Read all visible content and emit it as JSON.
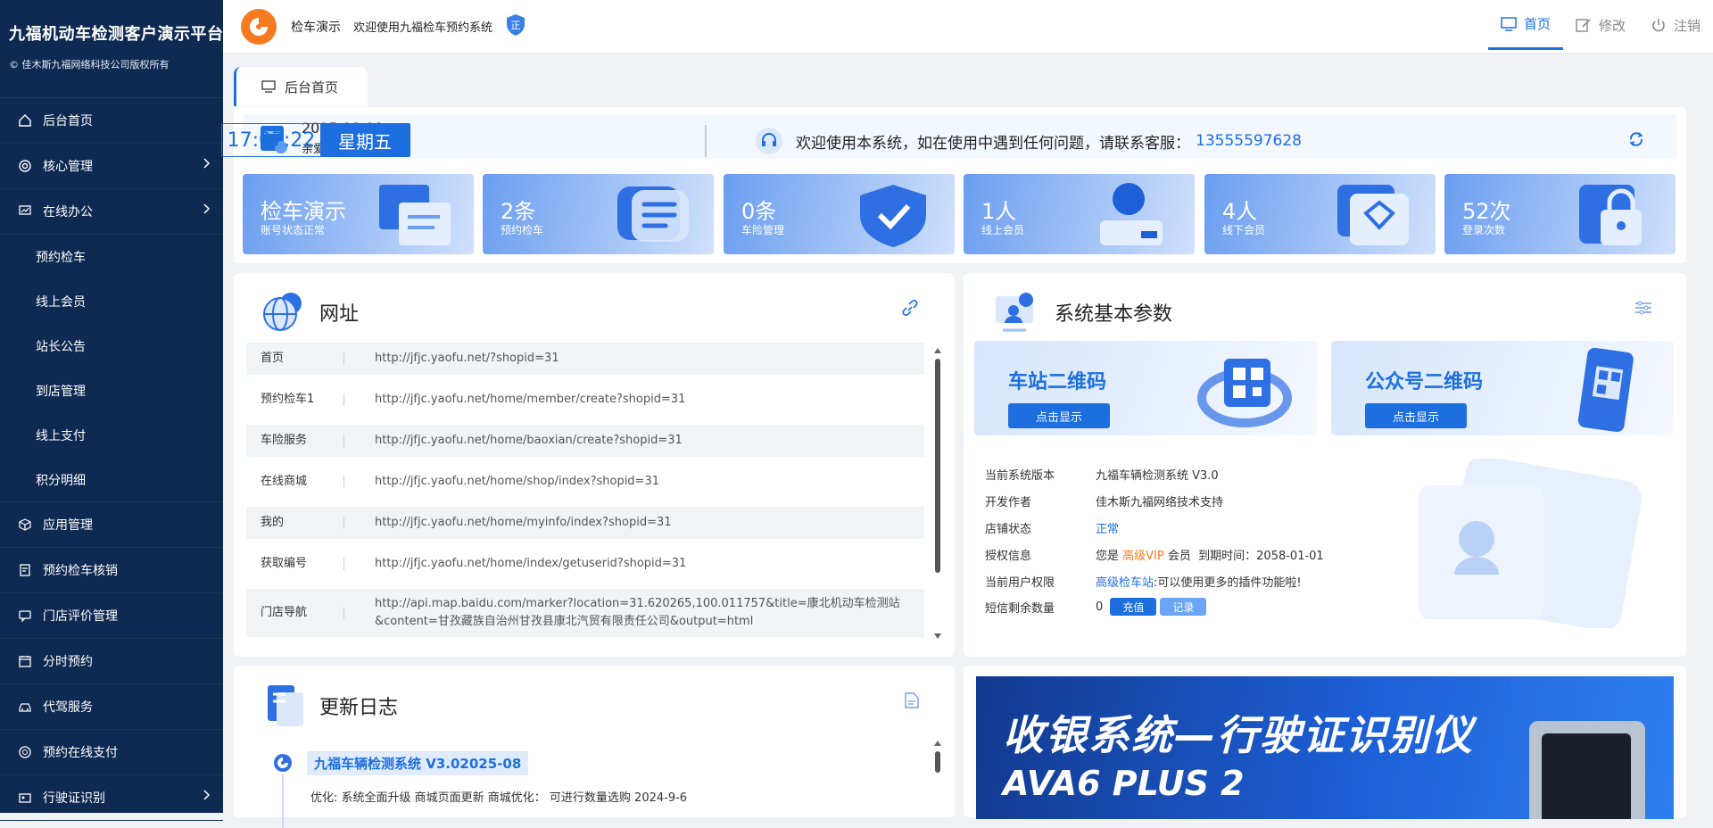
{
  "sidebar": {
    "title": "九福机动车检测客户演示平台",
    "copyright": "© 佳木斯九福网络科技公司版权所有",
    "items": [
      {
        "label": "后台首页",
        "icon": "home-icon"
      },
      {
        "label": "核心管理",
        "icon": "target-icon"
      },
      {
        "label": "在线办公",
        "icon": "monitor-chart-icon"
      }
    ],
    "subs": [
      "预约检车",
      "线上会员",
      "站长公告",
      "到店管理",
      "线上支付",
      "积分明细"
    ],
    "items2": [
      {
        "label": "应用管理",
        "icon": "cube-icon"
      },
      {
        "label": "预约检车核销",
        "icon": "clipboard-icon"
      },
      {
        "label": "门店评价管理",
        "icon": "comment-icon"
      },
      {
        "label": "分时预约",
        "icon": "calendar-icon"
      },
      {
        "label": "代驾服务",
        "icon": "car-icon"
      },
      {
        "label": "预约在线支付",
        "icon": "coin-icon"
      },
      {
        "label": "行驶证识别",
        "icon": "id-card-icon"
      }
    ]
  },
  "topbar": {
    "name": "检车演示",
    "welcome": "欢迎使用九福检车预约系统",
    "shield": "正",
    "home": "首页",
    "edit": "修改",
    "logout": "注销"
  },
  "tab": {
    "label": "后台首页"
  },
  "hero": {
    "date": "2025.08.08",
    "greeting": "亲爱的用户，下午好!",
    "time": "17:07:22",
    "weekday": "星期五",
    "notice": "欢迎使用本系统，如在使用中遇到任何问题，请联系客服：",
    "phone": "13555597628"
  },
  "cards": [
    {
      "value": "检车演示",
      "label": "账号状态正常"
    },
    {
      "value": "2条",
      "label": "预约检车"
    },
    {
      "value": "0条",
      "label": "车险管理"
    },
    {
      "value": "1人",
      "label": "线上会员"
    },
    {
      "value": "4人",
      "label": "线下会员"
    },
    {
      "value": "52次",
      "label": "登录次数"
    }
  ],
  "website": {
    "title": "网址",
    "rows": [
      {
        "k": "首页",
        "u": "http://jfjc.yaofu.net/?shopid=31"
      },
      {
        "k": "预约检车1",
        "u": "http://jfjc.yaofu.net/home/member/create?shopid=31"
      },
      {
        "k": "车险服务",
        "u": "http://jfjc.yaofu.net/home/baoxian/create?shopid=31"
      },
      {
        "k": "在线商城",
        "u": "http://jfjc.yaofu.net/home/shop/index?shopid=31"
      },
      {
        "k": "我的",
        "u": "http://jfjc.yaofu.net/home/myinfo/index?shopid=31"
      },
      {
        "k": "获取编号",
        "u": "http://jfjc.yaofu.net/home/index/getuserid?shopid=31"
      },
      {
        "k": "门店导航",
        "u": "http://api.map.baidu.com/marker?location=31.620265,100.011757&title=康北机动车检测站",
        "u2": "&content=甘孜藏族自治州甘孜县康北汽贸有限责任公司&output=html"
      }
    ]
  },
  "params": {
    "title": "系统基本参数",
    "qr1": {
      "title": "车站二维码",
      "btn": "点击显示"
    },
    "qr2": {
      "title": "公众号二维码",
      "btn": "点击显示"
    },
    "version": {
      "k": "当前系统版本",
      "v": "九福车辆检测系统 V3.0"
    },
    "author": {
      "k": "开发作者",
      "v": "佳木斯九福网络技术支持"
    },
    "status": {
      "k": "店铺状态",
      "v": "正常"
    },
    "auth": {
      "k": "授权信息",
      "pre": "您是",
      "vip": "高级VIP",
      "mid": "会员",
      "exp": "到期时间：2058-01-01"
    },
    "perm": {
      "k": "当前用户权限",
      "link": "高级检车站",
      "rest": ":可以使用更多的插件功能啦!"
    },
    "sms": {
      "k": "短信剩余数量",
      "v": "0",
      "recharge": "充值",
      "record": "记录"
    }
  },
  "log": {
    "title": "更新日志",
    "entry": "九福车辆检测系统 V3.02025-08",
    "line": "优化: 系统全面升级 商城页面更新 商城优化： 可进行数量选购 2024-9-6"
  },
  "banner": {
    "title": "收银系统—行驶证识别仪",
    "sub": "AVA6 PLUS 2"
  },
  "colors": {
    "primary": "#1d6fe0",
    "sidebar": "#0f2a52",
    "accent": "#f47b20"
  }
}
